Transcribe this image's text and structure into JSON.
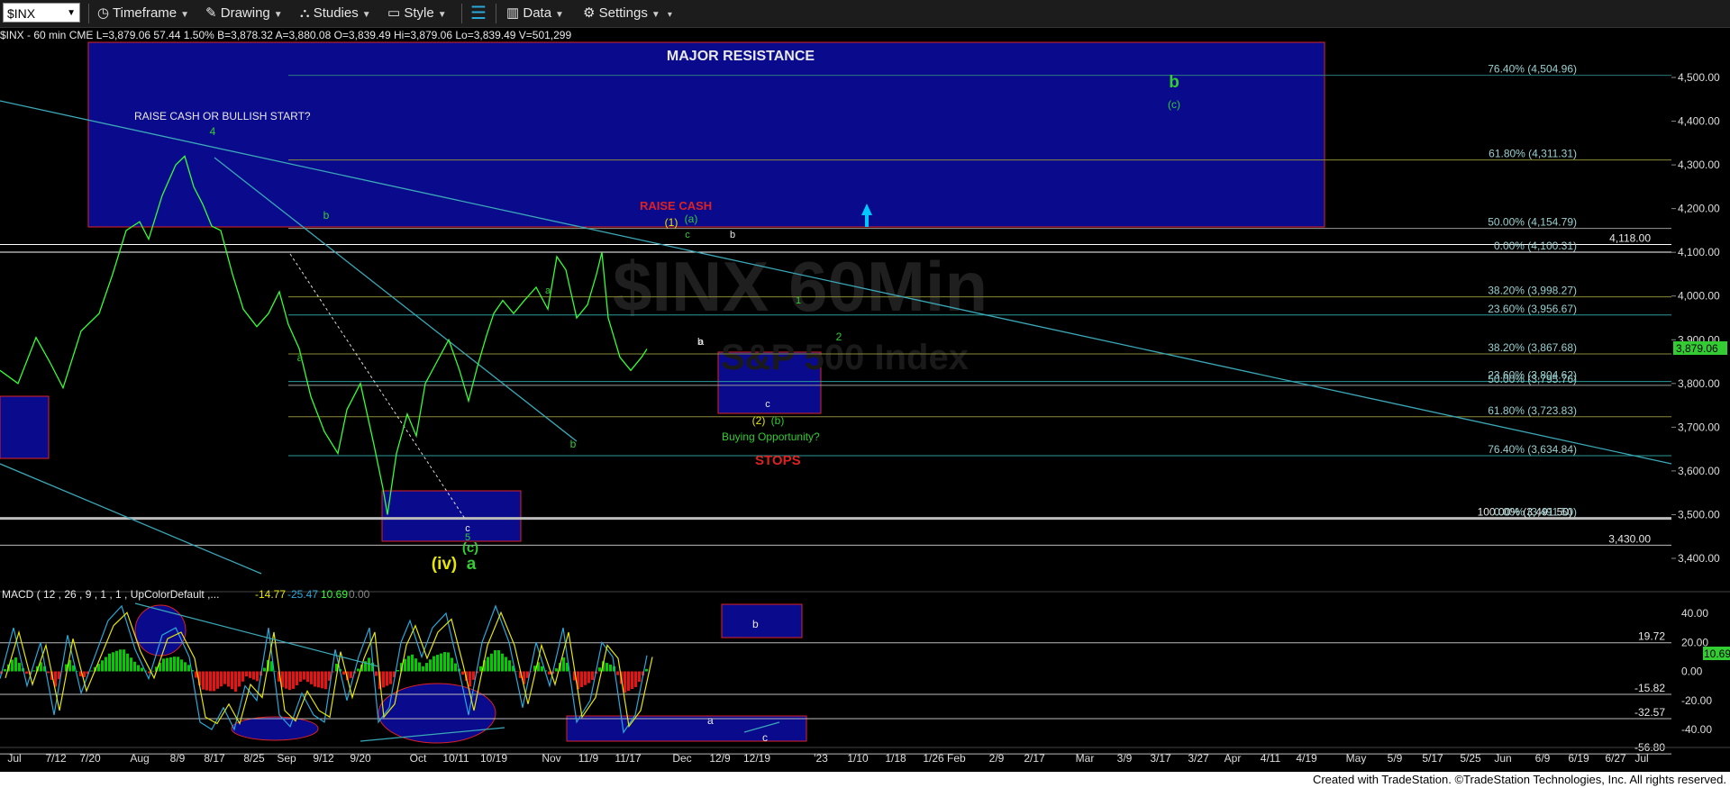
{
  "toolbar": {
    "symbol": "$INX",
    "timeframe": "Timeframe",
    "drawing": "Drawing",
    "studies": "Studies",
    "style": "Style",
    "data": "Data",
    "settings": "Settings"
  },
  "infobar": "$INX - 60 min  CME  L=3,879.06  57.44  1.50%  B=3,878.32  A=3,880.08  O=3,839.49  Hi=3,879.06  Lo=3,839.49  V=501,299",
  "annotations": {
    "major_resistance": "MAJOR RESISTANCE",
    "raise_cash_question": "RAISE CASH OR BULLISH START?",
    "raise_cash": "RAISE CASH",
    "buying_opportunity": "Buying Opportunity?",
    "stops": "STOPS",
    "watermark_1": "$INX 60Min",
    "watermark_2": "S&P 500 Index",
    "wave_labels": [
      "4",
      "b",
      "a",
      "b",
      "c",
      "5",
      "(c)",
      "(iv)",
      "a",
      "a",
      "b",
      "(1)",
      "(a)",
      "c",
      "b",
      "a",
      "c",
      "(2)",
      "(b)",
      "1",
      "2",
      "b",
      "(c)"
    ]
  },
  "fibs": [
    {
      "label": "76.40% (4,504.96)",
      "price": 4504.96
    },
    {
      "label": "61.80% (4,311.31)",
      "price": 4311.31
    },
    {
      "label": "50.00% (4,154.79)",
      "price": 4154.79
    },
    {
      "label": "4,118.00",
      "price": 4118
    },
    {
      "label": "0.00% (4,100.31)",
      "price": 4100.31
    },
    {
      "label": "38.20% (3,998.27)",
      "price": 3998.27
    },
    {
      "label": "23.60% (3,956.67)",
      "price": 3956.67
    },
    {
      "label": "38.20% (3,867.68)",
      "price": 3867.68
    },
    {
      "label": "23.60% (3,804.62)",
      "price": 3804.62
    },
    {
      "label": "50.00% (3,795.76)",
      "price": 3795.76
    },
    {
      "label": "61.80% (3,723.83)",
      "price": 3723.83
    },
    {
      "label": "76.40% (3,634.84)",
      "price": 3634.84
    },
    {
      "label": "100.00% (3,491.50)",
      "price": 3491.5
    },
    {
      "label": "0.00% (3,491.50)",
      "price": 3491.5
    },
    {
      "label": "3,430.00",
      "price": 3430
    }
  ],
  "current_price_label": "3,879.06",
  "price_axis": [
    "4,500.00",
    "4,400.00",
    "4,300.00",
    "4,200.00",
    "4,100.00",
    "4,000.00",
    "3,900.00",
    "3,800.00",
    "3,700.00",
    "3,600.00",
    "3,500.00",
    "3,400.00"
  ],
  "macd": {
    "header": "MACD ( 12 , 26 , 9 , 1 , 1 , UpColorDefault ,...",
    "v1": "-14.77",
    "v2": "-25.47",
    "v3": "10.69",
    "v4": "0.00",
    "axis": [
      "40.00",
      "20.00",
      "0.00",
      "-20.00",
      "-40.00"
    ],
    "levels": [
      {
        "label": "19.72",
        "value": 19.72
      },
      {
        "label": "-15.82",
        "value": -15.82
      },
      {
        "label": "-32.57",
        "value": -32.57
      },
      {
        "label": "-56.80",
        "value": -56.8
      }
    ],
    "current_label": "10.69",
    "box_labels": [
      "b",
      "a",
      "c"
    ]
  },
  "x_axis": [
    "Jul",
    "7/12",
    "7/20",
    "Aug",
    "8/9",
    "8/17",
    "8/25",
    "Sep",
    "9/12",
    "9/20",
    "Oct",
    "10/11",
    "10/19",
    "Nov",
    "11/9",
    "11/17",
    "Dec",
    "12/9",
    "12/19",
    "'23",
    "1/10",
    "1/18",
    "1/26 Feb",
    "2/9",
    "2/17",
    "Mar",
    "3/9",
    "3/17",
    "3/27",
    "Apr",
    "4/11",
    "4/19",
    "May",
    "5/9",
    "5/17",
    "5/25",
    "Jun",
    "6/9",
    "6/19",
    "6/27",
    "Jul"
  ],
  "footer": "Created with TradeStation. ©TradeStation Technologies, Inc. All rights reserved.",
  "colors": {
    "price_line": "#33ff33",
    "resistance_box": "#0a0a8c",
    "wave_green": "#33cc33",
    "wave_yellow": "#e6e600",
    "raise_cash": "#dd2222",
    "trendline": "#3aa8b8",
    "macd_pos": "#00cc00",
    "macd_neg": "#ee1111"
  },
  "price_series": [
    [
      0,
      3830
    ],
    [
      20,
      3800
    ],
    [
      40,
      3905
    ],
    [
      55,
      3850
    ],
    [
      70,
      3790
    ],
    [
      90,
      3920
    ],
    [
      110,
      3960
    ],
    [
      125,
      4050
    ],
    [
      140,
      4150
    ],
    [
      155,
      4170
    ],
    [
      165,
      4130
    ],
    [
      180,
      4230
    ],
    [
      195,
      4300
    ],
    [
      205,
      4320
    ],
    [
      215,
      4250
    ],
    [
      225,
      4210
    ],
    [
      235,
      4160
    ],
    [
      245,
      4150
    ],
    [
      258,
      4050
    ],
    [
      270,
      3970
    ],
    [
      285,
      3930
    ],
    [
      298,
      3960
    ],
    [
      310,
      4010
    ],
    [
      320,
      3935
    ],
    [
      332,
      3880
    ],
    [
      345,
      3770
    ],
    [
      360,
      3690
    ],
    [
      375,
      3640
    ],
    [
      385,
      3740
    ],
    [
      400,
      3800
    ],
    [
      415,
      3660
    ],
    [
      425,
      3560
    ],
    [
      430,
      3500
    ],
    [
      440,
      3640
    ],
    [
      452,
      3730
    ],
    [
      462,
      3680
    ],
    [
      472,
      3800
    ],
    [
      485,
      3850
    ],
    [
      498,
      3900
    ],
    [
      510,
      3830
    ],
    [
      520,
      3760
    ],
    [
      530,
      3840
    ],
    [
      540,
      3910
    ],
    [
      548,
      3960
    ],
    [
      558,
      3990
    ],
    [
      570,
      3960
    ],
    [
      582,
      3990
    ],
    [
      595,
      4020
    ],
    [
      608,
      3970
    ],
    [
      618,
      4090
    ],
    [
      628,
      4060
    ],
    [
      640,
      3950
    ],
    [
      652,
      3980
    ],
    [
      662,
      4050
    ],
    [
      668,
      4100
    ],
    [
      675,
      3950
    ],
    [
      688,
      3860
    ],
    [
      700,
      3830
    ],
    [
      712,
      3860
    ],
    [
      718,
      3879
    ]
  ],
  "macd_series": [
    [
      0,
      -5
    ],
    [
      15,
      30
    ],
    [
      30,
      -10
    ],
    [
      45,
      20
    ],
    [
      60,
      -30
    ],
    [
      75,
      25
    ],
    [
      90,
      -15
    ],
    [
      105,
      10
    ],
    [
      120,
      35
    ],
    [
      135,
      45
    ],
    [
      150,
      15
    ],
    [
      165,
      -5
    ],
    [
      180,
      25
    ],
    [
      195,
      30
    ],
    [
      210,
      10
    ],
    [
      222,
      -35
    ],
    [
      235,
      -40
    ],
    [
      248,
      -25
    ],
    [
      260,
      -40
    ],
    [
      272,
      -10
    ],
    [
      285,
      -20
    ],
    [
      298,
      30
    ],
    [
      310,
      -30
    ],
    [
      322,
      -38
    ],
    [
      335,
      -15
    ],
    [
      348,
      -30
    ],
    [
      360,
      -35
    ],
    [
      372,
      15
    ],
    [
      385,
      -20
    ],
    [
      398,
      10
    ],
    [
      410,
      30
    ],
    [
      420,
      -35
    ],
    [
      432,
      -25
    ],
    [
      445,
      20
    ],
    [
      455,
      35
    ],
    [
      468,
      10
    ],
    [
      480,
      30
    ],
    [
      495,
      40
    ],
    [
      508,
      5
    ],
    [
      520,
      -30
    ],
    [
      535,
      20
    ],
    [
      550,
      45
    ],
    [
      565,
      20
    ],
    [
      580,
      -25
    ],
    [
      595,
      20
    ],
    [
      610,
      -10
    ],
    [
      625,
      30
    ],
    [
      640,
      -35
    ],
    [
      655,
      -20
    ],
    [
      668,
      20
    ],
    [
      680,
      10
    ],
    [
      692,
      -42
    ],
    [
      705,
      -30
    ],
    [
      718,
      11
    ]
  ]
}
